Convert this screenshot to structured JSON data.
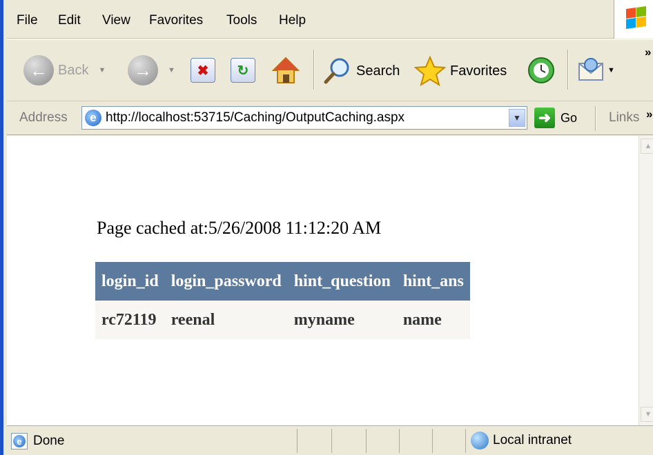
{
  "menu": [
    "File",
    "Edit",
    "View",
    "Favorites",
    "Tools",
    "Help"
  ],
  "toolbar": {
    "back": "Back",
    "search": "Search",
    "favorites": "Favorites",
    "more": "»"
  },
  "address": {
    "label": "Address",
    "url": "http://localhost:53715/Caching/OutputCaching.aspx",
    "go": "Go",
    "links": "Links",
    "more": "»"
  },
  "page": {
    "cached_text": "Page cached at:5/26/2008 11:12:20 AM",
    "table": {
      "headers": [
        "login_id",
        "login_password",
        "hint_question",
        "hint_ans"
      ],
      "rows": [
        [
          "rc72119",
          "reenal",
          "myname",
          "name"
        ]
      ]
    }
  },
  "status": {
    "text": "Done",
    "zone": "Local intranet"
  },
  "icons": {
    "back": "back-arrow-icon",
    "forward": "forward-arrow-icon",
    "stop": "stop-icon",
    "refresh": "refresh-icon",
    "home": "home-icon",
    "search": "search-icon",
    "favorites": "star-icon",
    "history": "history-icon",
    "mail": "mail-icon"
  },
  "colors": {
    "header_bg": "#5b7a9e",
    "row_bg": "#f7f6f3",
    "chrome": "#ece9d8"
  }
}
